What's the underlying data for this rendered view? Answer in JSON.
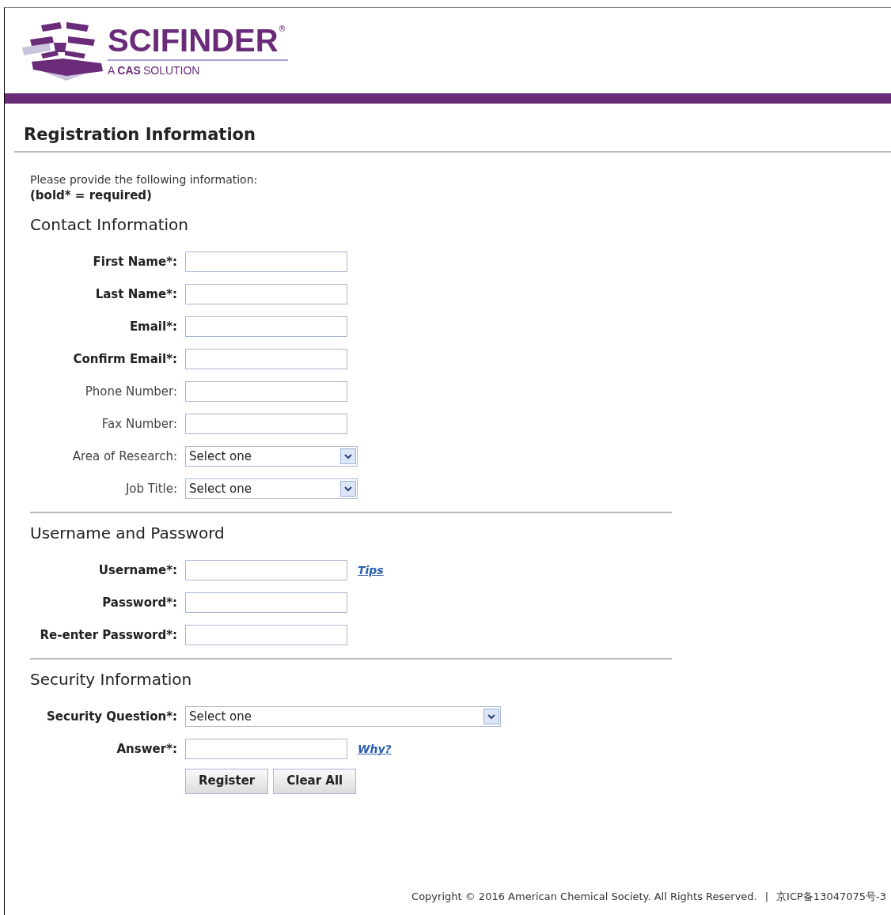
{
  "logo": {
    "name": "SCIFINDER",
    "registered": "®",
    "tagline_bold": "CAS",
    "tagline_prefix": "A",
    "tagline_suffix": "SOLUTION"
  },
  "page_title": "Registration Information",
  "intro": "Please provide the following information:",
  "legend": "(bold* = required)",
  "sections": [
    {
      "title": "Contact Information",
      "fields": [
        {
          "label": "First Name*:",
          "required": true,
          "kind": "text"
        },
        {
          "label": "Last Name*:",
          "required": true,
          "kind": "text"
        },
        {
          "label": "Email*:",
          "required": true,
          "kind": "text"
        },
        {
          "label": "Confirm Email*:",
          "required": true,
          "kind": "text"
        },
        {
          "label": "Phone Number:",
          "required": false,
          "kind": "text"
        },
        {
          "label": "Fax Number:",
          "required": false,
          "kind": "text"
        },
        {
          "label": "Area of Research:",
          "required": false,
          "kind": "select",
          "value": "Select one"
        },
        {
          "label": "Job Title:",
          "required": false,
          "kind": "select",
          "value": "Select one"
        }
      ]
    },
    {
      "title": "Username and Password",
      "fields": [
        {
          "label": "Username*:",
          "required": true,
          "kind": "text",
          "link": "Tips"
        },
        {
          "label": "Password*:",
          "required": true,
          "kind": "text"
        },
        {
          "label": "Re-enter Password*:",
          "required": true,
          "kind": "text"
        }
      ]
    },
    {
      "title": "Security Information",
      "fields": [
        {
          "label": "Security Question*:",
          "required": true,
          "kind": "wide-select",
          "value": "Select one"
        },
        {
          "label": "Answer*:",
          "required": true,
          "kind": "text",
          "link": "Why?"
        }
      ]
    }
  ],
  "buttons": [
    "Register",
    "Clear All"
  ],
  "footer": {
    "copyright": "Copyright © 2016 American Chemical Society. All Rights Reserved.",
    "separator": "|",
    "license": "京ICP备13047075号-3"
  }
}
